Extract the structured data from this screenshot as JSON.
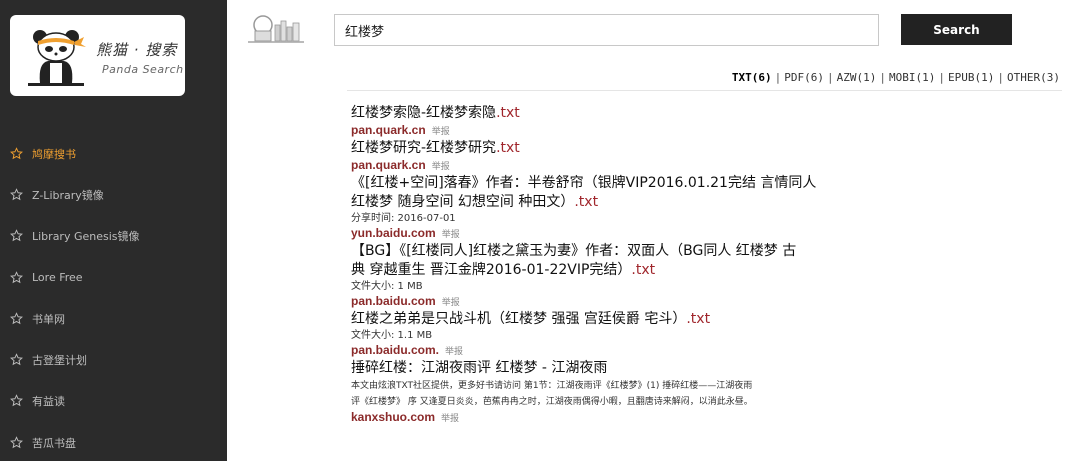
{
  "logo": {
    "cn": "熊猫 · 搜索",
    "en": "Panda Search"
  },
  "sidebar": {
    "items": [
      {
        "label": "鸠摩搜书",
        "active": true
      },
      {
        "label": "Z-Library镜像",
        "active": false
      },
      {
        "label": "Library Genesis镜像",
        "active": false
      },
      {
        "label": "Lore Free",
        "active": false
      },
      {
        "label": "书单网",
        "active": false
      },
      {
        "label": "古登堡计划",
        "active": false
      },
      {
        "label": "有益读",
        "active": false
      },
      {
        "label": "苦瓜书盘",
        "active": false
      }
    ]
  },
  "search": {
    "value": "红楼梦",
    "button_label": "Search"
  },
  "filters": [
    {
      "label": "TXT(6)",
      "active": true
    },
    {
      "label": "PDF(6)",
      "active": false
    },
    {
      "label": "AZW(1)",
      "active": false
    },
    {
      "label": "MOBI(1)",
      "active": false
    },
    {
      "label": "EPUB(1)",
      "active": false
    },
    {
      "label": "OTHER(3)",
      "active": false
    }
  ],
  "filter_separator": "|",
  "report_label": "举报",
  "results": [
    {
      "title_lines": [
        "红楼梦索隐-红楼梦索隐"
      ],
      "ext": ".txt",
      "meta": "",
      "snippet": [],
      "source": "pan.quark.cn"
    },
    {
      "title_lines": [
        "红楼梦研究-红楼梦研究"
      ],
      "ext": ".txt",
      "meta": "",
      "snippet": [],
      "source": "pan.quark.cn"
    },
    {
      "title_lines": [
        "《[红楼+空间]落春》作者：半卷舒帘（银牌VIP2016.01.21完结 言情同人",
        "红楼梦 随身空间 幻想空间 种田文）"
      ],
      "ext": ".txt",
      "meta": "分享时间: 2016-07-01",
      "snippet": [],
      "source": "yun.baidu.com"
    },
    {
      "title_lines": [
        "【BG】《[红楼同人]红楼之黛玉为妻》作者：双面人（BG同人 红楼梦 古",
        "典 穿越重生 晋江金牌2016-01-22VIP完结）"
      ],
      "ext": ".txt",
      "meta": "文件大小: 1 MB",
      "snippet": [],
      "source": "pan.baidu.com"
    },
    {
      "title_lines": [
        "红楼之弟弟是只战斗机（红楼梦 强强 宫廷侯爵 宅斗）"
      ],
      "ext": ".txt",
      "meta": "文件大小: 1.1 MB",
      "snippet": [],
      "source": "pan.baidu.com."
    },
    {
      "title_lines": [
        "捶碎红楼：江湖夜雨评 红楼梦 - 江湖夜雨"
      ],
      "ext": "",
      "meta": "",
      "snippet": [
        "本文由炫浪TXT社区提供，更多好书请访问 第1节：江湖夜雨评《红楼梦》(1) 捶碎红楼——江湖夜雨",
        "评《红楼梦》 序 又逢夏日炎炎，芭蕉冉冉之时，江湖夜雨偶得小暇，且翻唐诗来解闷，以消此永昼。"
      ],
      "source": "kanxshuo.com"
    }
  ]
}
